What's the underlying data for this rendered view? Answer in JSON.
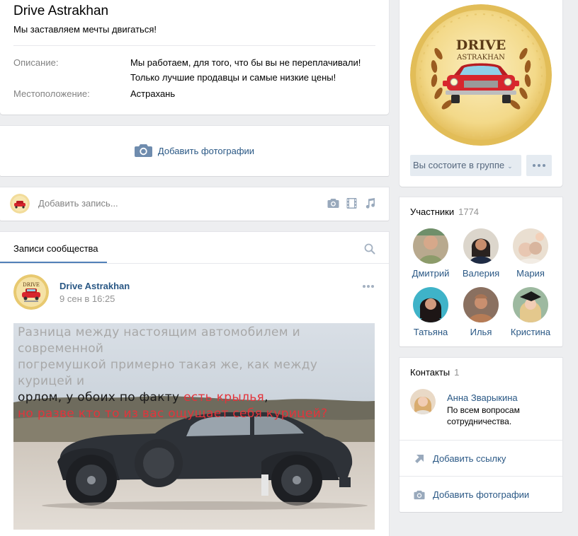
{
  "group": {
    "title": "Drive Astrakhan",
    "status": "Мы заставляем мечты двигаться!",
    "description_label": "Описание:",
    "description_line1": "Мы работаем, для того, что бы вы не переплачивали!",
    "description_line2": "Только лучшие продавцы и самые низкие цены!",
    "location_label": "Местоположение:",
    "location_value": "Астрахань"
  },
  "logo_text": {
    "line1": "DRIVE",
    "line2": "ASTRAKHAN"
  },
  "photos": {
    "add_label": "Добавить фотографии"
  },
  "composer": {
    "placeholder": "Добавить запись..."
  },
  "feed": {
    "tab_label": "Записи сообщества",
    "post": {
      "author": "Drive Astrakhan",
      "date": "9 сен в 16:25",
      "caption_line1": "Разница между настоящим автомобилем и современной",
      "caption_line2": "погремушкой примерно такая же, как между курицей и",
      "caption_line3_a": "орлом, у обоих по факту ",
      "caption_line3_b": "есть крылья",
      "caption_line3_c": ",",
      "caption_line4": "но разве кто то из вас ощущает себя курицей?"
    }
  },
  "sidebar": {
    "member_button": "Вы состоите в группе",
    "members_title": "Участники",
    "members_count": "1774",
    "members": [
      {
        "name": "Дмитрий"
      },
      {
        "name": "Валерия"
      },
      {
        "name": "Мария"
      },
      {
        "name": "Татьяна"
      },
      {
        "name": "Илья"
      },
      {
        "name": "Кристина"
      }
    ],
    "contacts_title": "Контакты",
    "contacts_count": "1",
    "contact": {
      "name": "Анна Зварыкина",
      "desc_line1": "По всем вопросам",
      "desc_line2": "сотрудничества."
    },
    "add_link": "Добавить ссылку",
    "add_photos": "Добавить фотографии"
  },
  "colors": {
    "link": "#2a5885",
    "accent": "#5181b8",
    "background": "#edeef0",
    "gold": "#e9c46a",
    "car_red": "#d7262d"
  },
  "icons": [
    "camera-icon",
    "film-icon",
    "music-icon",
    "search-icon",
    "more-icon",
    "link-icon",
    "chevron-down-icon"
  ]
}
